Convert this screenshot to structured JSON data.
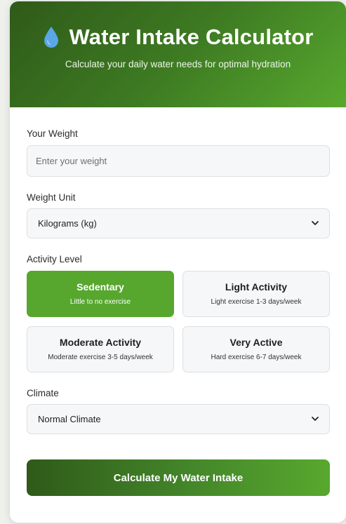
{
  "header": {
    "icon": "water-drop-icon",
    "title": "Water Intake Calculator",
    "subtitle": "Calculate your daily water needs for optimal hydration"
  },
  "weight": {
    "label": "Your Weight",
    "placeholder": "Enter your weight",
    "value": ""
  },
  "unit": {
    "label": "Weight Unit",
    "selected": "Kilograms (kg)"
  },
  "activity": {
    "label": "Activity Level",
    "options": [
      {
        "title": "Sedentary",
        "desc": "Little to no exercise",
        "selected": true
      },
      {
        "title": "Light Activity",
        "desc": "Light exercise 1-3 days/week",
        "selected": false
      },
      {
        "title": "Moderate Activity",
        "desc": "Moderate exercise 3-5 days/week",
        "selected": false
      },
      {
        "title": "Very Active",
        "desc": "Hard exercise 6-7 days/week",
        "selected": false
      }
    ]
  },
  "climate": {
    "label": "Climate",
    "selected": "Normal Climate"
  },
  "calculate_label": "Calculate My Water Intake",
  "colors": {
    "accent": "#57a72f",
    "header_dark": "#2f5a19",
    "drop": "#5aa6e6"
  }
}
